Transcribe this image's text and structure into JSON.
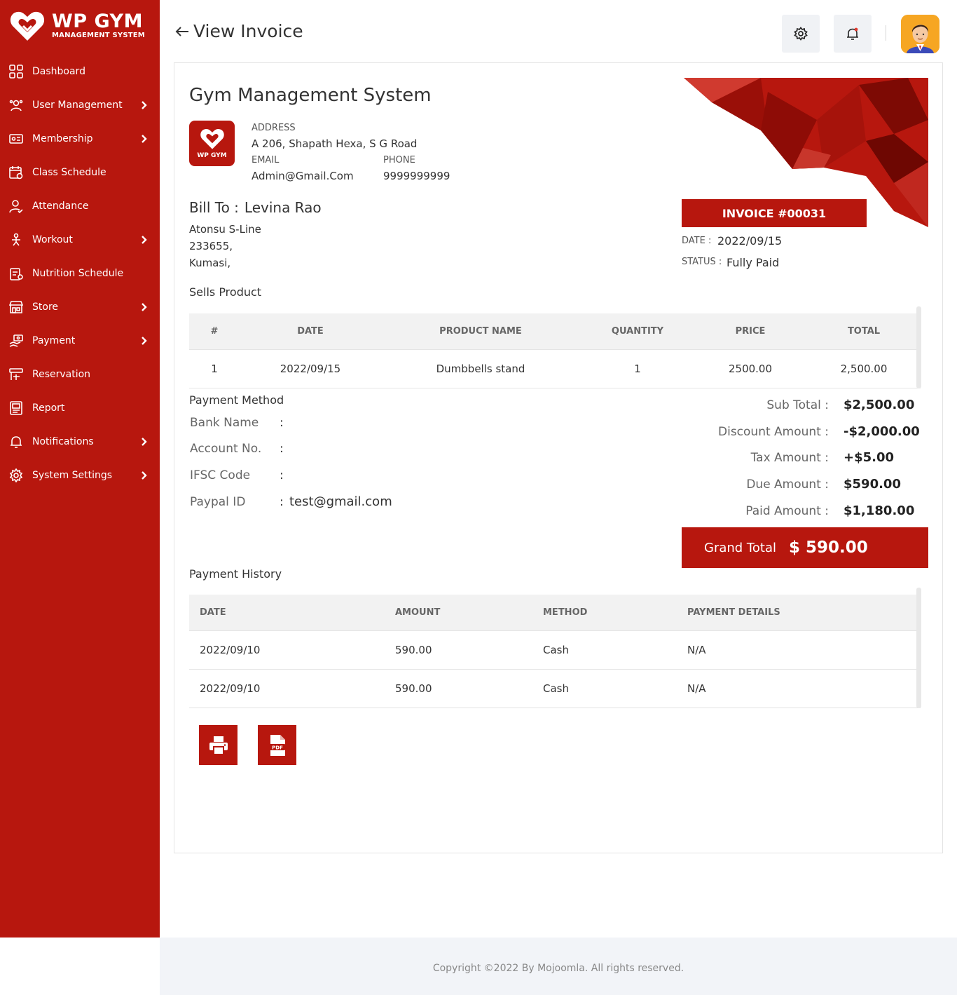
{
  "brand": {
    "title": "WP GYM",
    "subtitle": "MANAGEMENT SYSTEM",
    "color": "#b7170e"
  },
  "sidebar": {
    "items": [
      {
        "label": "Dashboard",
        "icon": "dashboard-icon",
        "has_submenu": false
      },
      {
        "label": "User Management",
        "icon": "users-icon",
        "has_submenu": true
      },
      {
        "label": "Membership",
        "icon": "membership-card-icon",
        "has_submenu": true
      },
      {
        "label": "Class Schedule",
        "icon": "calendar-icon",
        "has_submenu": false
      },
      {
        "label": "Attendance",
        "icon": "user-check-icon",
        "has_submenu": false
      },
      {
        "label": "Workout",
        "icon": "workout-icon",
        "has_submenu": true
      },
      {
        "label": "Nutrition Schedule",
        "icon": "nutrition-icon",
        "has_submenu": false
      },
      {
        "label": "Store",
        "icon": "store-icon",
        "has_submenu": true
      },
      {
        "label": "Payment",
        "icon": "payment-icon",
        "has_submenu": true
      },
      {
        "label": "Reservation",
        "icon": "reservation-icon",
        "has_submenu": false
      },
      {
        "label": "Report",
        "icon": "report-icon",
        "has_submenu": false
      },
      {
        "label": "Notifications",
        "icon": "bell-icon",
        "has_submenu": true
      },
      {
        "label": "System Settings",
        "icon": "gear-icon",
        "has_submenu": true
      }
    ]
  },
  "header": {
    "title": "View Invoice"
  },
  "invoice": {
    "org_name": "Gym Management System",
    "logo_text": "WP GYM",
    "address_label": "ADDRESS",
    "address": "A 206, Shapath Hexa, S G Road",
    "email_label": "EMAIL",
    "email": "Admin@Gmail.Com",
    "phone_label": "PHONE",
    "phone": "9999999999",
    "bill_to_label": "Bill To :",
    "bill_to_name": "Levina Rao",
    "bill_address": [
      "Atonsu S-Line",
      "233655,",
      "Kumasi,"
    ],
    "number": "INVOICE #00031",
    "date_label": "DATE :",
    "date": "2022/09/15",
    "status_label": "STATUS :",
    "status": "Fully Paid"
  },
  "products": {
    "title": "Sells Product",
    "headers": [
      "#",
      "DATE",
      "PRODUCT NAME",
      "QUANTITY",
      "PRICE",
      "TOTAL"
    ],
    "rows": [
      [
        "1",
        "2022/09/15",
        "Dumbbells stand",
        "1",
        "2500.00",
        "2,500.00"
      ]
    ]
  },
  "payment_method": {
    "title": "Payment Method",
    "fields": [
      {
        "label": "Bank Name",
        "value": ""
      },
      {
        "label": "Account No.",
        "value": ""
      },
      {
        "label": "IFSC Code",
        "value": ""
      },
      {
        "label": "Paypal ID",
        "value": "test@gmail.com"
      }
    ]
  },
  "totals": {
    "rows": [
      {
        "label": "Sub Total :",
        "value": "$2,500.00"
      },
      {
        "label": "Discount Amount :",
        "value": "-$2,000.00"
      },
      {
        "label": "Tax Amount :",
        "value": "+$5.00"
      },
      {
        "label": "Due Amount :",
        "value": "$590.00"
      },
      {
        "label": "Paid Amount :",
        "value": "$1,180.00"
      }
    ],
    "grand_label": "Grand Total",
    "grand_value": "$ 590.00"
  },
  "history": {
    "title": "Payment History",
    "headers": [
      "DATE",
      "AMOUNT",
      "METHOD",
      "PAYMENT DETAILS"
    ],
    "rows": [
      [
        "2022/09/10",
        "590.00",
        "Cash",
        "N/A"
      ],
      [
        "2022/09/10",
        "590.00",
        "Cash",
        "N/A"
      ]
    ]
  },
  "actions": {
    "print_icon": "print-icon",
    "pdf_icon": "pdf-icon",
    "pdf_text": "PDF"
  },
  "footer": {
    "text": "Copyright ©2022 By Mojoomla. All rights reserved."
  }
}
